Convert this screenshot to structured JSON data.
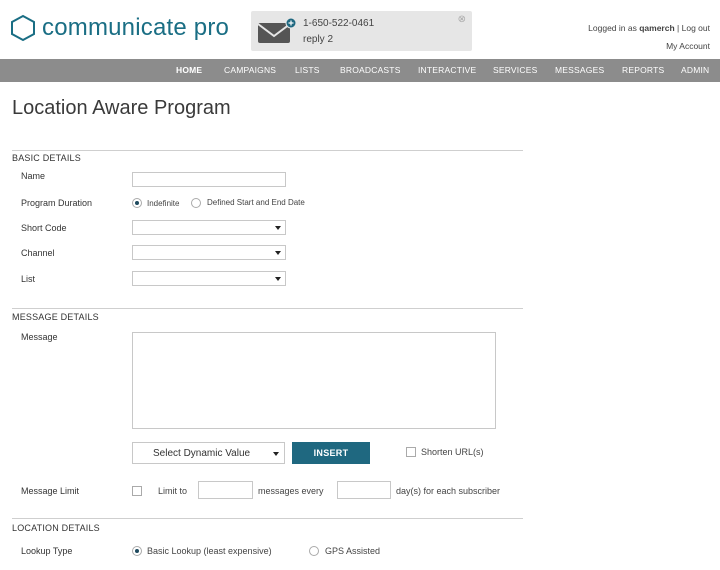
{
  "app": {
    "name": "communicate pro",
    "brand_color": "#1a6e84"
  },
  "notification": {
    "phone": "1-650-522-0461",
    "message": "reply 2",
    "icon": "envelope-icon",
    "badge_icon": "plus-icon",
    "close_icon": "close-icon"
  },
  "account": {
    "logged_in_prefix": "Logged in as",
    "username": "qamerch",
    "separator": "|",
    "logout": "Log out",
    "my_account": "My Account"
  },
  "nav": {
    "items": [
      "HOME",
      "CAMPAIGNS",
      "LISTS",
      "BROADCASTS",
      "INTERACTIVE",
      "SERVICES",
      "MESSAGES",
      "REPORTS",
      "ADMIN"
    ],
    "active": "HOME"
  },
  "page": {
    "title": "Location Aware Program"
  },
  "basic": {
    "heading": "BASIC DETAILS",
    "name_label": "Name",
    "name_value": "",
    "duration_label": "Program Duration",
    "duration_options": [
      "Indefinite",
      "Defined Start and End Date"
    ],
    "duration_selected": "Indefinite",
    "short_code_label": "Short Code",
    "short_code_value": "",
    "channel_label": "Channel",
    "channel_value": "",
    "list_label": "List",
    "list_value": ""
  },
  "message": {
    "heading": "MESSAGE DETAILS",
    "message_label": "Message",
    "message_value": "",
    "dynamic_value_placeholder": "Select Dynamic Value",
    "insert_label": "INSERT",
    "insert_color": "#1f6880",
    "shorten_urls_label": "Shorten URL(s)",
    "shorten_urls_checked": false,
    "limit_label": "Message Limit",
    "limit_to": "Limit to",
    "messages_every": "messages every",
    "days_suffix": "day(s) for each subscriber",
    "limit_checked": false
  },
  "location": {
    "heading": "LOCATION DETAILS",
    "lookup_label": "Lookup Type",
    "lookup_options": [
      "Basic Lookup (least expensive)",
      "GPS Assisted"
    ],
    "lookup_selected": "Basic Lookup (least expensive)"
  }
}
